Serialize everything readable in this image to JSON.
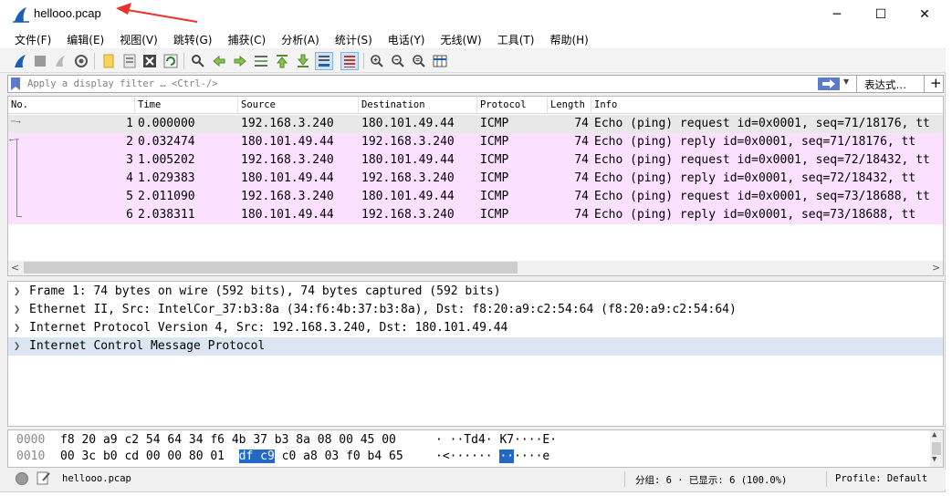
{
  "window": {
    "title": "hellooo.pcap",
    "controls": [
      "─",
      "☐",
      "✕"
    ]
  },
  "menu": [
    "文件(F)",
    "编辑(E)",
    "视图(V)",
    "跳转(G)",
    "捕获(C)",
    "分析(A)",
    "统计(S)",
    "电话(Y)",
    "无线(W)",
    "工具(T)",
    "帮助(H)"
  ],
  "filter": {
    "placeholder": "Apply a display filter … <Ctrl-/>",
    "expression_label": "表达式…",
    "add_label": "+"
  },
  "packet_list": {
    "columns": [
      "No.",
      "Time",
      "Source",
      "Destination",
      "Protocol",
      "Length",
      "Info"
    ],
    "rows": [
      {
        "no": "1",
        "time": "0.000000",
        "src": "192.168.3.240",
        "dst": "180.101.49.44",
        "proto": "ICMP",
        "len": "74",
        "info": "Echo (ping) request  id=0x0001, seq=71/18176, tt"
      },
      {
        "no": "2",
        "time": "0.032474",
        "src": "180.101.49.44",
        "dst": "192.168.3.240",
        "proto": "ICMP",
        "len": "74",
        "info": "Echo (ping) reply    id=0x0001, seq=71/18176, tt"
      },
      {
        "no": "3",
        "time": "1.005202",
        "src": "192.168.3.240",
        "dst": "180.101.49.44",
        "proto": "ICMP",
        "len": "74",
        "info": "Echo (ping) request  id=0x0001, seq=72/18432, tt"
      },
      {
        "no": "4",
        "time": "1.029383",
        "src": "180.101.49.44",
        "dst": "192.168.3.240",
        "proto": "ICMP",
        "len": "74",
        "info": "Echo (ping) reply    id=0x0001, seq=72/18432, tt"
      },
      {
        "no": "5",
        "time": "2.011090",
        "src": "192.168.3.240",
        "dst": "180.101.49.44",
        "proto": "ICMP",
        "len": "74",
        "info": "Echo (ping) request  id=0x0001, seq=73/18688, tt"
      },
      {
        "no": "6",
        "time": "2.038311",
        "src": "180.101.49.44",
        "dst": "192.168.3.240",
        "proto": "ICMP",
        "len": "74",
        "info": "Echo (ping) reply    id=0x0001, seq=73/18688, tt"
      }
    ]
  },
  "details": [
    "Frame 1: 74 bytes on wire (592 bits), 74 bytes captured (592 bits)",
    "Ethernet II, Src: IntelCor_37:b3:8a (34:f6:4b:37:b3:8a), Dst: f8:20:a9:c2:54:64 (f8:20:a9:c2:54:64)",
    "Internet Protocol Version 4, Src: 192.168.3.240, Dst: 180.101.49.44",
    "Internet Control Message Protocol"
  ],
  "bytes": {
    "row1": {
      "offset": "0000",
      "hex": "f8 20 a9 c2 54 64 34 f6  4b 37 b3 8a 08 00 45 00",
      "ascii": "· ··Td4· K7····E·"
    },
    "row2": {
      "offset": "0010",
      "hex_a": "00 3c b0 cd 00 00 80 01  ",
      "hex_hl": "df c9",
      "hex_b": " c0 a8 03 f0 b4 65",
      "ascii_a": "·<······ ",
      "ascii_hl": "··",
      "ascii_b": "····e"
    }
  },
  "status": {
    "file": "hellooo.pcap",
    "stats": "分组: 6 · 已显示: 6 (100.0%)",
    "profile": "Profile: Default"
  },
  "colors": {
    "selected_row": "#e8e8e8",
    "icmp_row": "#fce0ff",
    "detail_highlight": "#dbe6f2",
    "byte_highlight": "#2368c4",
    "annotation_arrow": "#e8342b"
  }
}
